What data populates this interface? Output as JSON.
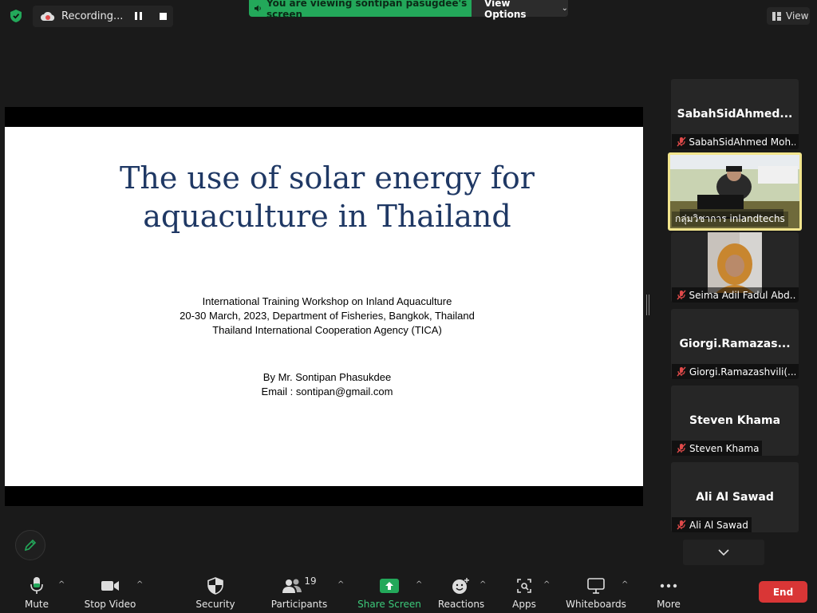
{
  "recording": {
    "label": "Recording..."
  },
  "banner": {
    "text": "You are viewing sontipan pasugdee's screen",
    "view_options": "View Options"
  },
  "view_button": {
    "label": "View"
  },
  "slide": {
    "title_line1": "The use of solar energy for",
    "title_line2": "aquaculture in Thailand",
    "sub_line1": "International Training Workshop on Inland Aquaculture",
    "sub_line2": "20-30 March, 2023, Department of Fisheries, Bangkok, Thailand",
    "sub_line3": "Thailand International Cooperation Agency (TICA)",
    "by_line": "By Mr. Sontipan Phasukdee",
    "email_line": "Email : sontipan@gmail.com",
    "title_color": "#1f3864"
  },
  "participants": [
    {
      "big_name": "SabahSidAhmed...",
      "label": "SabahSidAhmed Moh...",
      "muted": true
    },
    {
      "big_name": "",
      "label": "กลุ่มวิชาการ inlandtechs",
      "muted": false,
      "video": true,
      "active": true
    },
    {
      "big_name": "",
      "label": "Seima Adil Fadul Abd...",
      "muted": true,
      "video": true
    },
    {
      "big_name": "Giorgi.Ramazas...",
      "label": "Giorgi.Ramazashvili(...",
      "muted": true
    },
    {
      "big_name": "Steven Khama",
      "label": "Steven Khama",
      "muted": true
    },
    {
      "big_name": "Ali Al Sawad",
      "label": "Ali Al Sawad",
      "muted": true
    }
  ],
  "toolbar": {
    "mute": "Mute",
    "stop_video": "Stop Video",
    "security": "Security",
    "participants": "Participants",
    "participants_count": "19",
    "share_screen": "Share Screen",
    "reactions": "Reactions",
    "apps": "Apps",
    "whiteboards": "Whiteboards",
    "more": "More",
    "end": "End"
  },
  "colors": {
    "accent_green": "#23a85a",
    "end_red": "#d93636",
    "active_border": "#f2e58d",
    "muted_red": "#e04a4a"
  },
  "icons": [
    "shield-icon",
    "recording-icon",
    "pause-icon",
    "stop-icon",
    "speaker-icon",
    "chevron-down-icon",
    "grid-icon",
    "pencil-icon",
    "mic-icon",
    "video-camera-icon",
    "shield-security-icon",
    "participants-icon",
    "share-screen-icon",
    "reactions-icon",
    "apps-icon",
    "whiteboard-icon",
    "more-icon",
    "muted-mic-icon"
  ]
}
